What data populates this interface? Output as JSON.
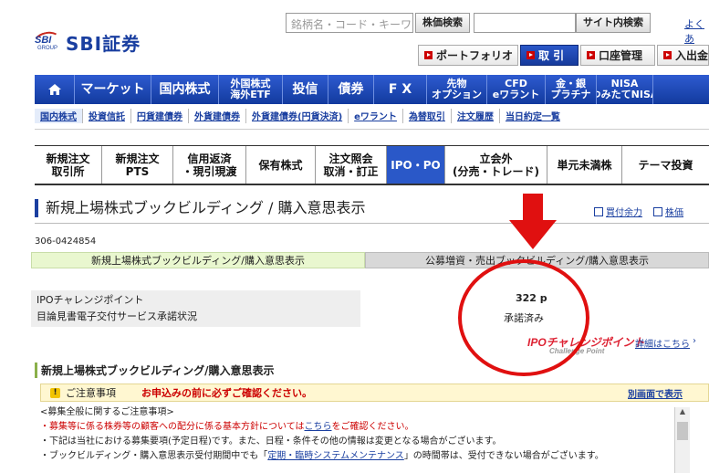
{
  "header": {
    "logo_text": "SBI証券",
    "logo_mark": "SBI",
    "logo_group": "GROUP",
    "search_placeholder": "銘柄名・コード・キーワ",
    "stock_search_btn": "株価検索",
    "site_search_btn": "サイト内検索",
    "yokuaru": "よくあ",
    "portfolio": "ポートフォリオ",
    "torihiki": "取 引",
    "account": "口座管理",
    "deposit": "入出金"
  },
  "main_nav": [
    "マーケット",
    "国内株式",
    "外国株式\n海外ETF",
    "投信",
    "債券",
    "F X",
    "先物\nオプション",
    "CFD\neワラント",
    "金・銀\nプラチナ",
    "NISA\nつみたてNISA"
  ],
  "sub_nav": [
    "国内株式",
    "投資信託",
    "円貨建債券",
    "外貨建債券",
    "外貨建債券(円貨決済)",
    "eワラント",
    "為替取引",
    "注文履歴",
    "当日約定一覧"
  ],
  "tabs": [
    "新規注文\n取引所",
    "新規注文\nPTS",
    "信用返済\n・現引現渡",
    "保有株式",
    "注文照会\n取消・訂正",
    "IPO・PO",
    "立会外\n(分売・トレード)",
    "単元未満株",
    "テーマ投資"
  ],
  "page": {
    "title": "新規上場株式ブックビルディング / 購入意思表示",
    "link_kaitsuke": "買付余力",
    "link_kabuka": "株価",
    "account_no": "306-0424854",
    "subtab1": "新規上場株式ブックビルディング/購入意思表示",
    "subtab2": "公募増資・売出ブックビルディング/購入意思表示",
    "ipo_point_label": "IPOチャレンジポイント",
    "consent_label": "目論見書電子交付サービス承諾状況",
    "ipo_point_value": "322 p",
    "consent_value": "承諾済み",
    "ipo_logo": "IPOチャレンジポイント",
    "ipo_logo_sub": "Challenge Point",
    "detail_link": "詳細はこちら",
    "section_title": "新規上場株式ブックビルディング/購入意思表示",
    "notice_title": "ご注意事項",
    "notice_red": "お申込みの前に必ずご確認ください。",
    "notice_separate": "別画面で表示",
    "notice_line1": "<募集全般に関するご注意事項>",
    "notice_line2a": "・募集等に係る株券等の顧客への配分に係る基本方針については",
    "notice_line2_link": "こちら",
    "notice_line2b": "をご確認ください。",
    "notice_line3": "・下記は当社における募集要項(予定日程)です。また、日程・条件その他の情報は変更となる場合がございます。",
    "notice_line4a": "・ブックビルディング・購入意思表示受付期間中でも「",
    "notice_line4_link": "定期・臨時システムメンテナンス",
    "notice_line4b": "」の時間帯は、受付できない場合がございます。"
  }
}
